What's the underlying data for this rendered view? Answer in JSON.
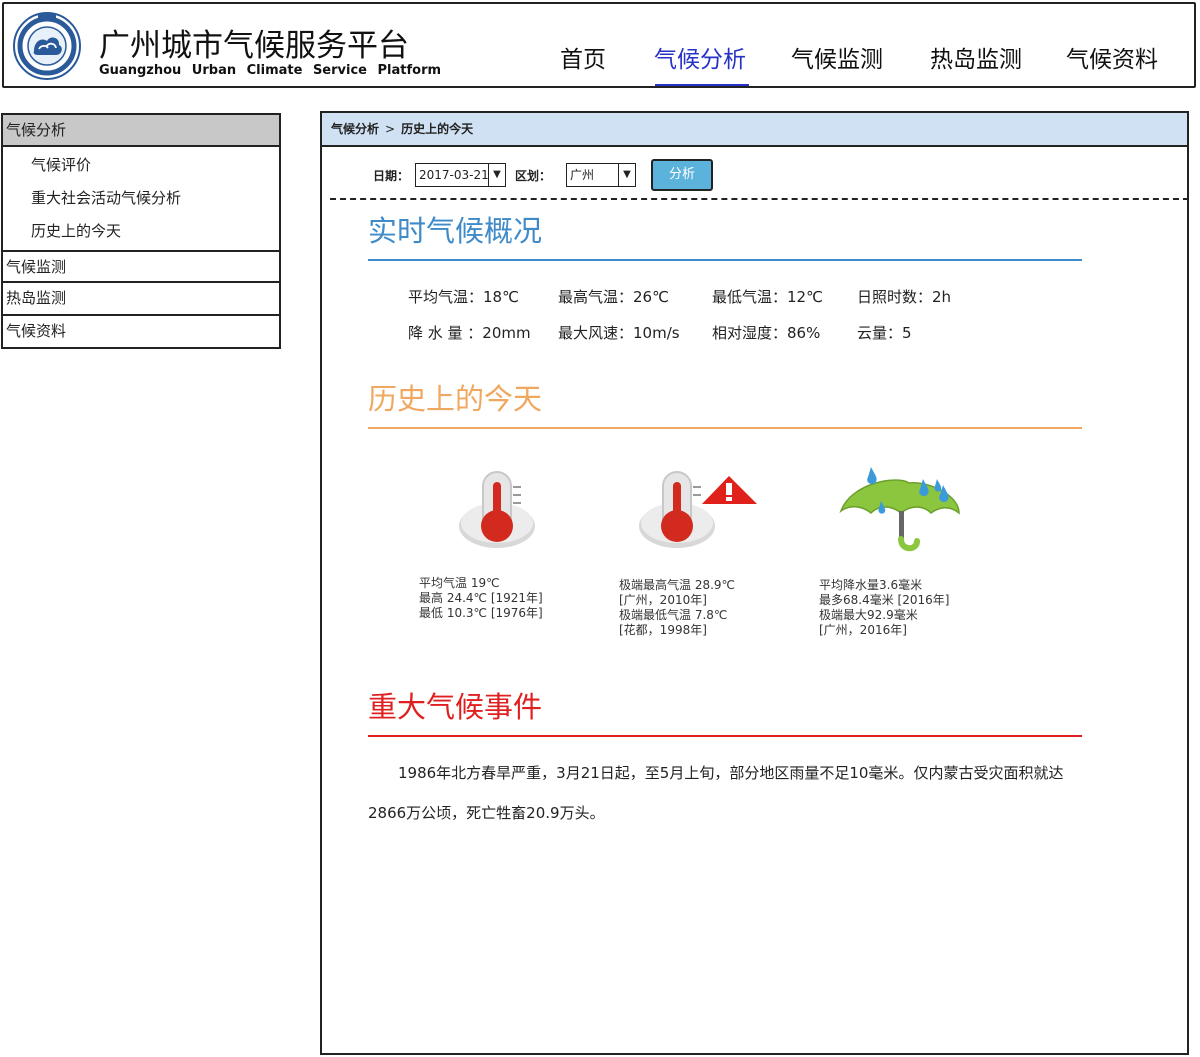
{
  "header": {
    "title_cn": "广州城市气候服务平台",
    "title_en": "Guangzhou  Urban  Climate  Service  Platform"
  },
  "nav": [
    {
      "label": "首页"
    },
    {
      "label": "气候分析",
      "active": true
    },
    {
      "label": "气候监测"
    },
    {
      "label": "热岛监测"
    },
    {
      "label": "气候资料"
    }
  ],
  "sidebar": {
    "head": "气候分析",
    "subitems": [
      "气候评价",
      "重大社会活动气候分析",
      "历史上的今天"
    ],
    "items": [
      "气候监测",
      "热岛监测",
      "气候资料"
    ]
  },
  "breadcrumb": {
    "parent": "气候分析",
    "separator": ">",
    "current": "历史上的今天"
  },
  "filters": {
    "date_label": "日期：",
    "date_value": "2017-03-21",
    "district_label": "区划：",
    "district_value": "广州",
    "analyze_button": "分析"
  },
  "realtime": {
    "title": "实时气候概况",
    "color": "#3f8ac8",
    "stats": [
      "平均气温：18℃",
      "最高气温：26℃",
      "最低气温：12℃",
      "日照时数：2h",
      "降 水 量 ：20mm",
      "最大风速：10m/s",
      "相对湿度：86%",
      "云量：5"
    ]
  },
  "history": {
    "title": "历史上的今天",
    "color": "#f0a860",
    "cards": [
      {
        "icon": "thermometer-icon",
        "lines": [
          "平均气温 19℃",
          "最高 24.4℃ [1921年]",
          "最低 10.3℃ [1976年]"
        ]
      },
      {
        "icon": "thermometer-alert-icon",
        "lines": [
          "极端最高气温 28.9℃",
          "[广州，2010年]",
          "极端最低气温 7.8℃",
          "[花都，1998年]"
        ]
      },
      {
        "icon": "umbrella-rain-icon",
        "lines": [
          "平均降水量3.6毫米",
          "最多68.4毫米 [2016年]",
          "极端最大92.9毫米",
          "[广州，2016年]"
        ]
      }
    ]
  },
  "events": {
    "title": "重大气候事件",
    "color": "#e02020",
    "text": "1986年北方春旱严重，3月21日起，至5月上旬，部分地区雨量不足10毫米。仅内蒙古受灾面积就达2866万公顷，死亡牲畜20.9万头。"
  },
  "colors": {
    "nav_active": "#2732c7",
    "breadcrumb_bg": "#cfe1f3",
    "button_bg": "#5bb3db",
    "sidebar_head_bg": "#c8c8c8"
  }
}
